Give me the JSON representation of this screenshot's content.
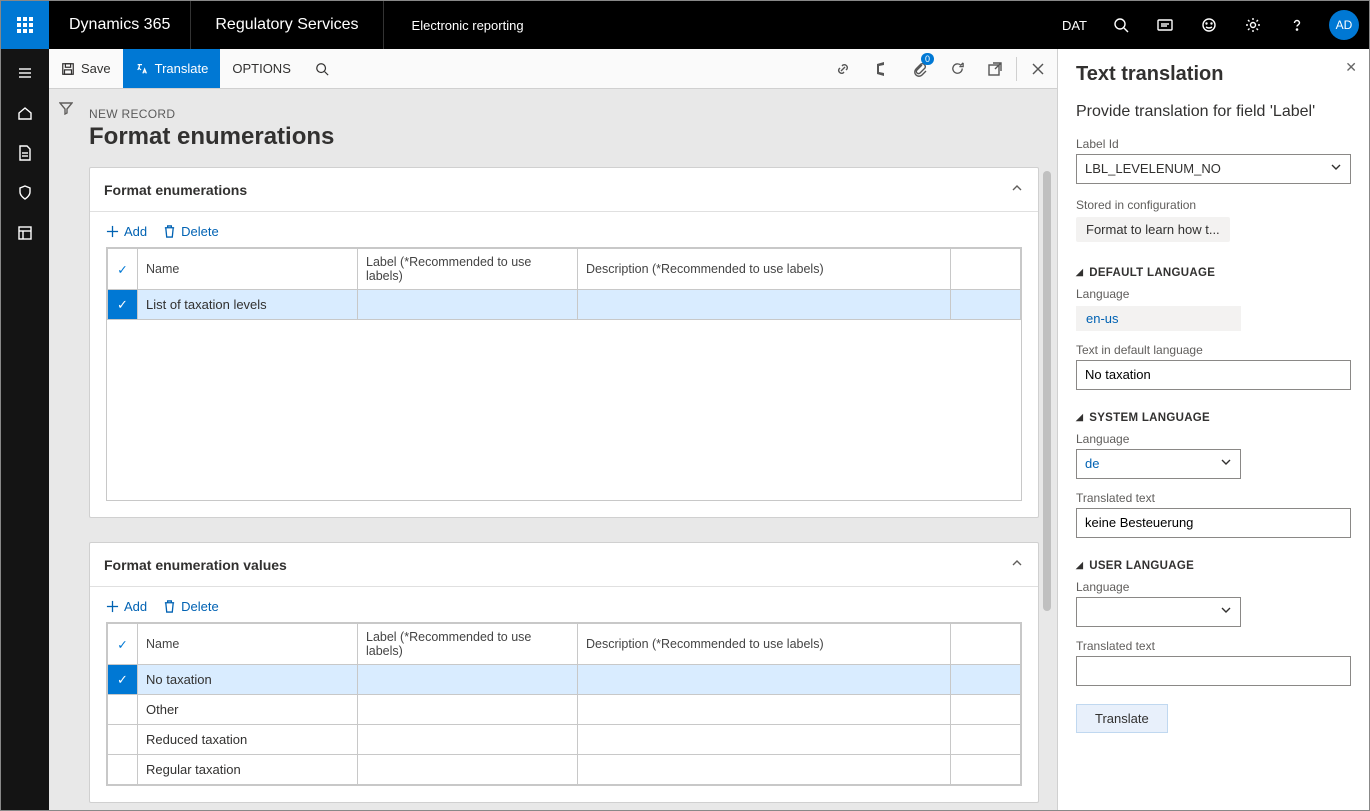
{
  "topnav": {
    "brand": "Dynamics 365",
    "module": "Regulatory Services",
    "breadcrumb": "Electronic reporting",
    "company": "DAT",
    "avatar": "AD"
  },
  "actionbar": {
    "save": "Save",
    "translate": "Translate",
    "options": "OPTIONS",
    "badge": "0"
  },
  "page": {
    "subtitle": "NEW RECORD",
    "title": "Format enumerations"
  },
  "card1": {
    "title": "Format enumerations",
    "add": "Add",
    "delete": "Delete",
    "cols": {
      "name": "Name",
      "label": "Label (*Recommended to use labels)",
      "desc": "Description (*Recommended to use labels)"
    },
    "rows": [
      {
        "name": "List of taxation levels",
        "label": "",
        "desc": "",
        "selected": true
      }
    ]
  },
  "card2": {
    "title": "Format enumeration values",
    "add": "Add",
    "delete": "Delete",
    "cols": {
      "name": "Name",
      "label": "Label (*Recommended to use labels)",
      "desc": "Description (*Recommended to use labels)"
    },
    "rows": [
      {
        "name": "No taxation",
        "label": "",
        "desc": "",
        "selected": true
      },
      {
        "name": "Other",
        "label": "",
        "desc": "",
        "selected": false
      },
      {
        "name": "Reduced taxation",
        "label": "",
        "desc": "",
        "selected": false
      },
      {
        "name": "Regular taxation",
        "label": "",
        "desc": "",
        "selected": false
      }
    ]
  },
  "panel": {
    "heading": "Text translation",
    "subheading": "Provide translation for field 'Label'",
    "labelId": {
      "label": "Label Id",
      "value": "LBL_LEVELENUM_NO"
    },
    "stored": {
      "label": "Stored in configuration",
      "value": "Format to learn how t..."
    },
    "default": {
      "heading": "DEFAULT LANGUAGE",
      "langLabel": "Language",
      "lang": "en-us",
      "textLabel": "Text in default language",
      "text": "No taxation"
    },
    "system": {
      "heading": "SYSTEM LANGUAGE",
      "langLabel": "Language",
      "lang": "de",
      "textLabel": "Translated text",
      "text": "keine Besteuerung"
    },
    "user": {
      "heading": "USER LANGUAGE",
      "langLabel": "Language",
      "lang": "",
      "textLabel": "Translated text",
      "text": ""
    },
    "translateBtn": "Translate"
  }
}
